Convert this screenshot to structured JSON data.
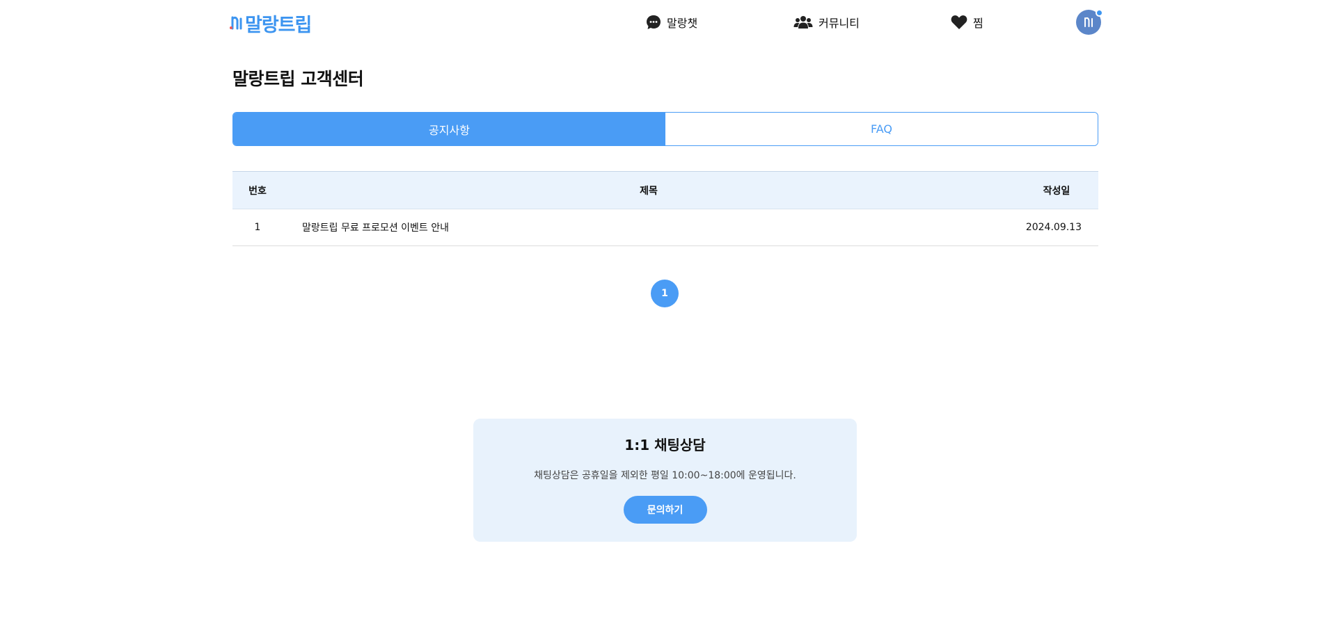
{
  "header": {
    "logo_text": "말랑트립",
    "nav": {
      "chat_label": "말랑챗",
      "community_label": "커뮤니티",
      "wish_label": "찜"
    },
    "icons": {
      "chat": "chat-bubble-icon",
      "community": "users-icon",
      "wish": "heart-icon",
      "avatar": "user-avatar-icon"
    }
  },
  "page_title": "말랑트립 고객센터",
  "tabs": [
    {
      "label": "공지사항",
      "active": true
    },
    {
      "label": "FAQ",
      "active": false
    }
  ],
  "table": {
    "headers": {
      "no": "번호",
      "title": "제목",
      "date": "작성일"
    },
    "rows": [
      {
        "no": "1",
        "title": "말랑트립 무료 프로모션 이벤트 안내",
        "date": "2024.09.13"
      }
    ]
  },
  "pagination": {
    "current": "1"
  },
  "consult": {
    "title": "1:1 채팅상담",
    "description": "채팅상담은 공휴일을 제외한 평일 10:00~18:00에 운영됩니다.",
    "button_label": "문의하기"
  },
  "colors": {
    "accent": "#4a9cf5",
    "logo": "#3d95f0",
    "header_row_bg": "#eaf3fd",
    "consult_bg": "#e8f2fc"
  }
}
